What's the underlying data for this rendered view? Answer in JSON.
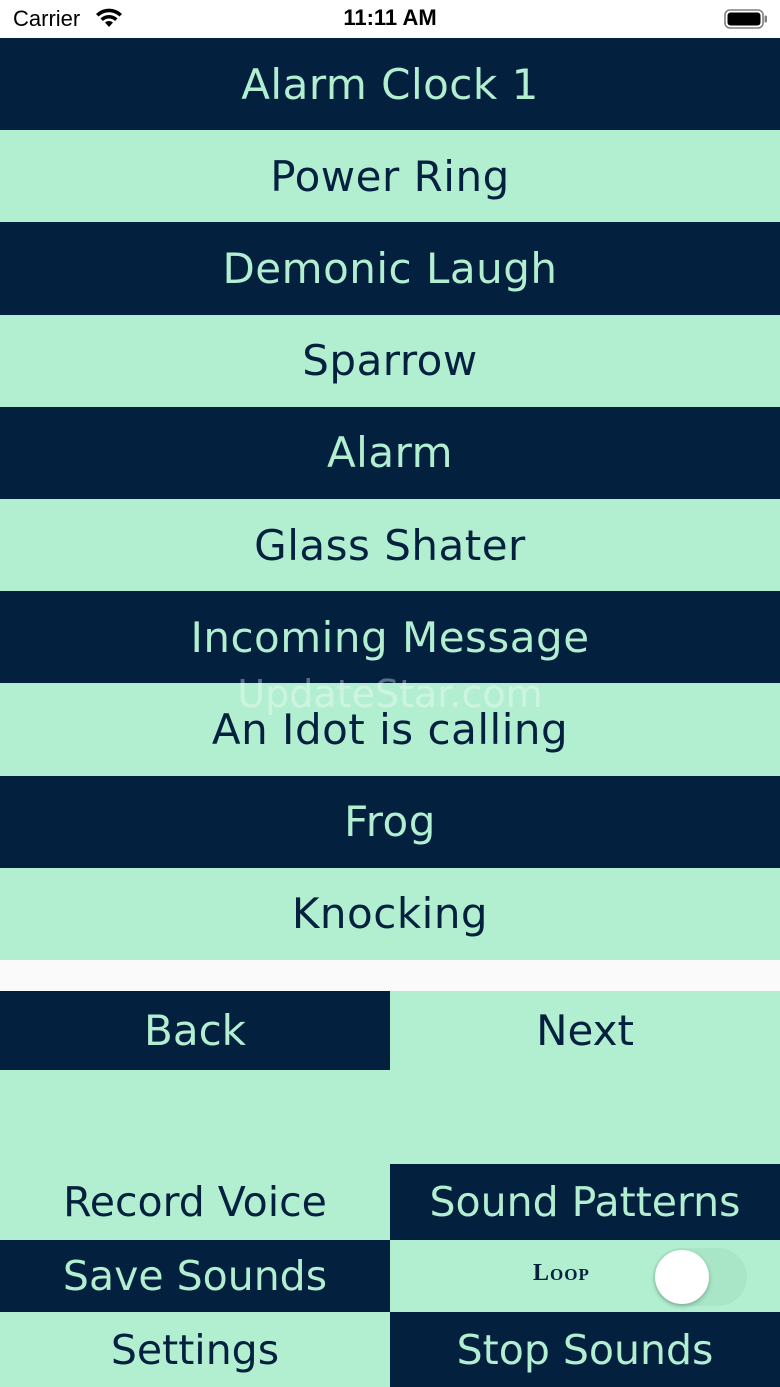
{
  "status_bar": {
    "carrier": "Carrier",
    "time": "11:11 AM"
  },
  "sounds": [
    {
      "label": "Alarm Clock 1",
      "style": "dark"
    },
    {
      "label": "Power Ring",
      "style": "light"
    },
    {
      "label": "Demonic Laugh",
      "style": "dark"
    },
    {
      "label": "Sparrow",
      "style": "light"
    },
    {
      "label": "Alarm",
      "style": "dark"
    },
    {
      "label": "Glass Shater",
      "style": "light"
    },
    {
      "label": "Incoming Message",
      "style": "dark"
    },
    {
      "label": "An Idot is calling",
      "style": "light"
    },
    {
      "label": "Frog",
      "style": "dark"
    },
    {
      "label": "Knocking",
      "style": "light"
    }
  ],
  "nav": {
    "back_label": "Back",
    "next_label": "Next"
  },
  "controls": {
    "record_voice": "Record Voice",
    "sound_patterns": "Sound Patterns",
    "save_sounds": "Save Sounds",
    "loop_label": "Loop",
    "loop_on": false,
    "settings": "Settings",
    "stop_sounds": "Stop Sounds"
  },
  "watermark": "UpdateStar.com",
  "colors": {
    "dark": "#04203f",
    "light": "#b2efd1"
  }
}
